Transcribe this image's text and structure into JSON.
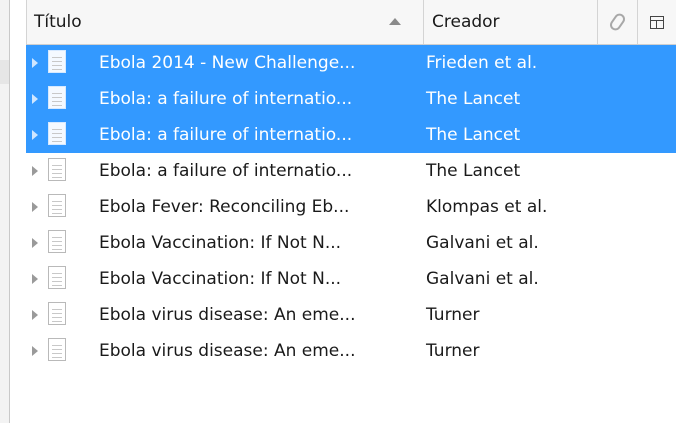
{
  "columns": {
    "title": "Título",
    "creator": "Creador",
    "attachment_icon": "paperclip-icon",
    "picker_icon": "column-picker-icon"
  },
  "rows": [
    {
      "title": "Ebola 2014 - New Challenge...",
      "creator": "Frieden et al.",
      "selected": true
    },
    {
      "title": "Ebola: a failure of internatio...",
      "creator": "The Lancet",
      "selected": true
    },
    {
      "title": "Ebola: a failure of internatio...",
      "creator": "The Lancet",
      "selected": true
    },
    {
      "title": "Ebola: a failure of internatio...",
      "creator": "The Lancet",
      "selected": false
    },
    {
      "title": "Ebola Fever: Reconciling Eb...",
      "creator": "Klompas et al.",
      "selected": false
    },
    {
      "title": "Ebola Vaccination: If Not N...",
      "creator": "Galvani et al.",
      "selected": false
    },
    {
      "title": "Ebola Vaccination: If Not N...",
      "creator": "Galvani et al.",
      "selected": false
    },
    {
      "title": "Ebola virus disease: An eme...",
      "creator": "Turner",
      "selected": false
    },
    {
      "title": "Ebola virus disease: An eme...",
      "creator": "Turner",
      "selected": false
    }
  ],
  "colors": {
    "selection": "#3399ff",
    "selection_text": "#ffffff"
  }
}
